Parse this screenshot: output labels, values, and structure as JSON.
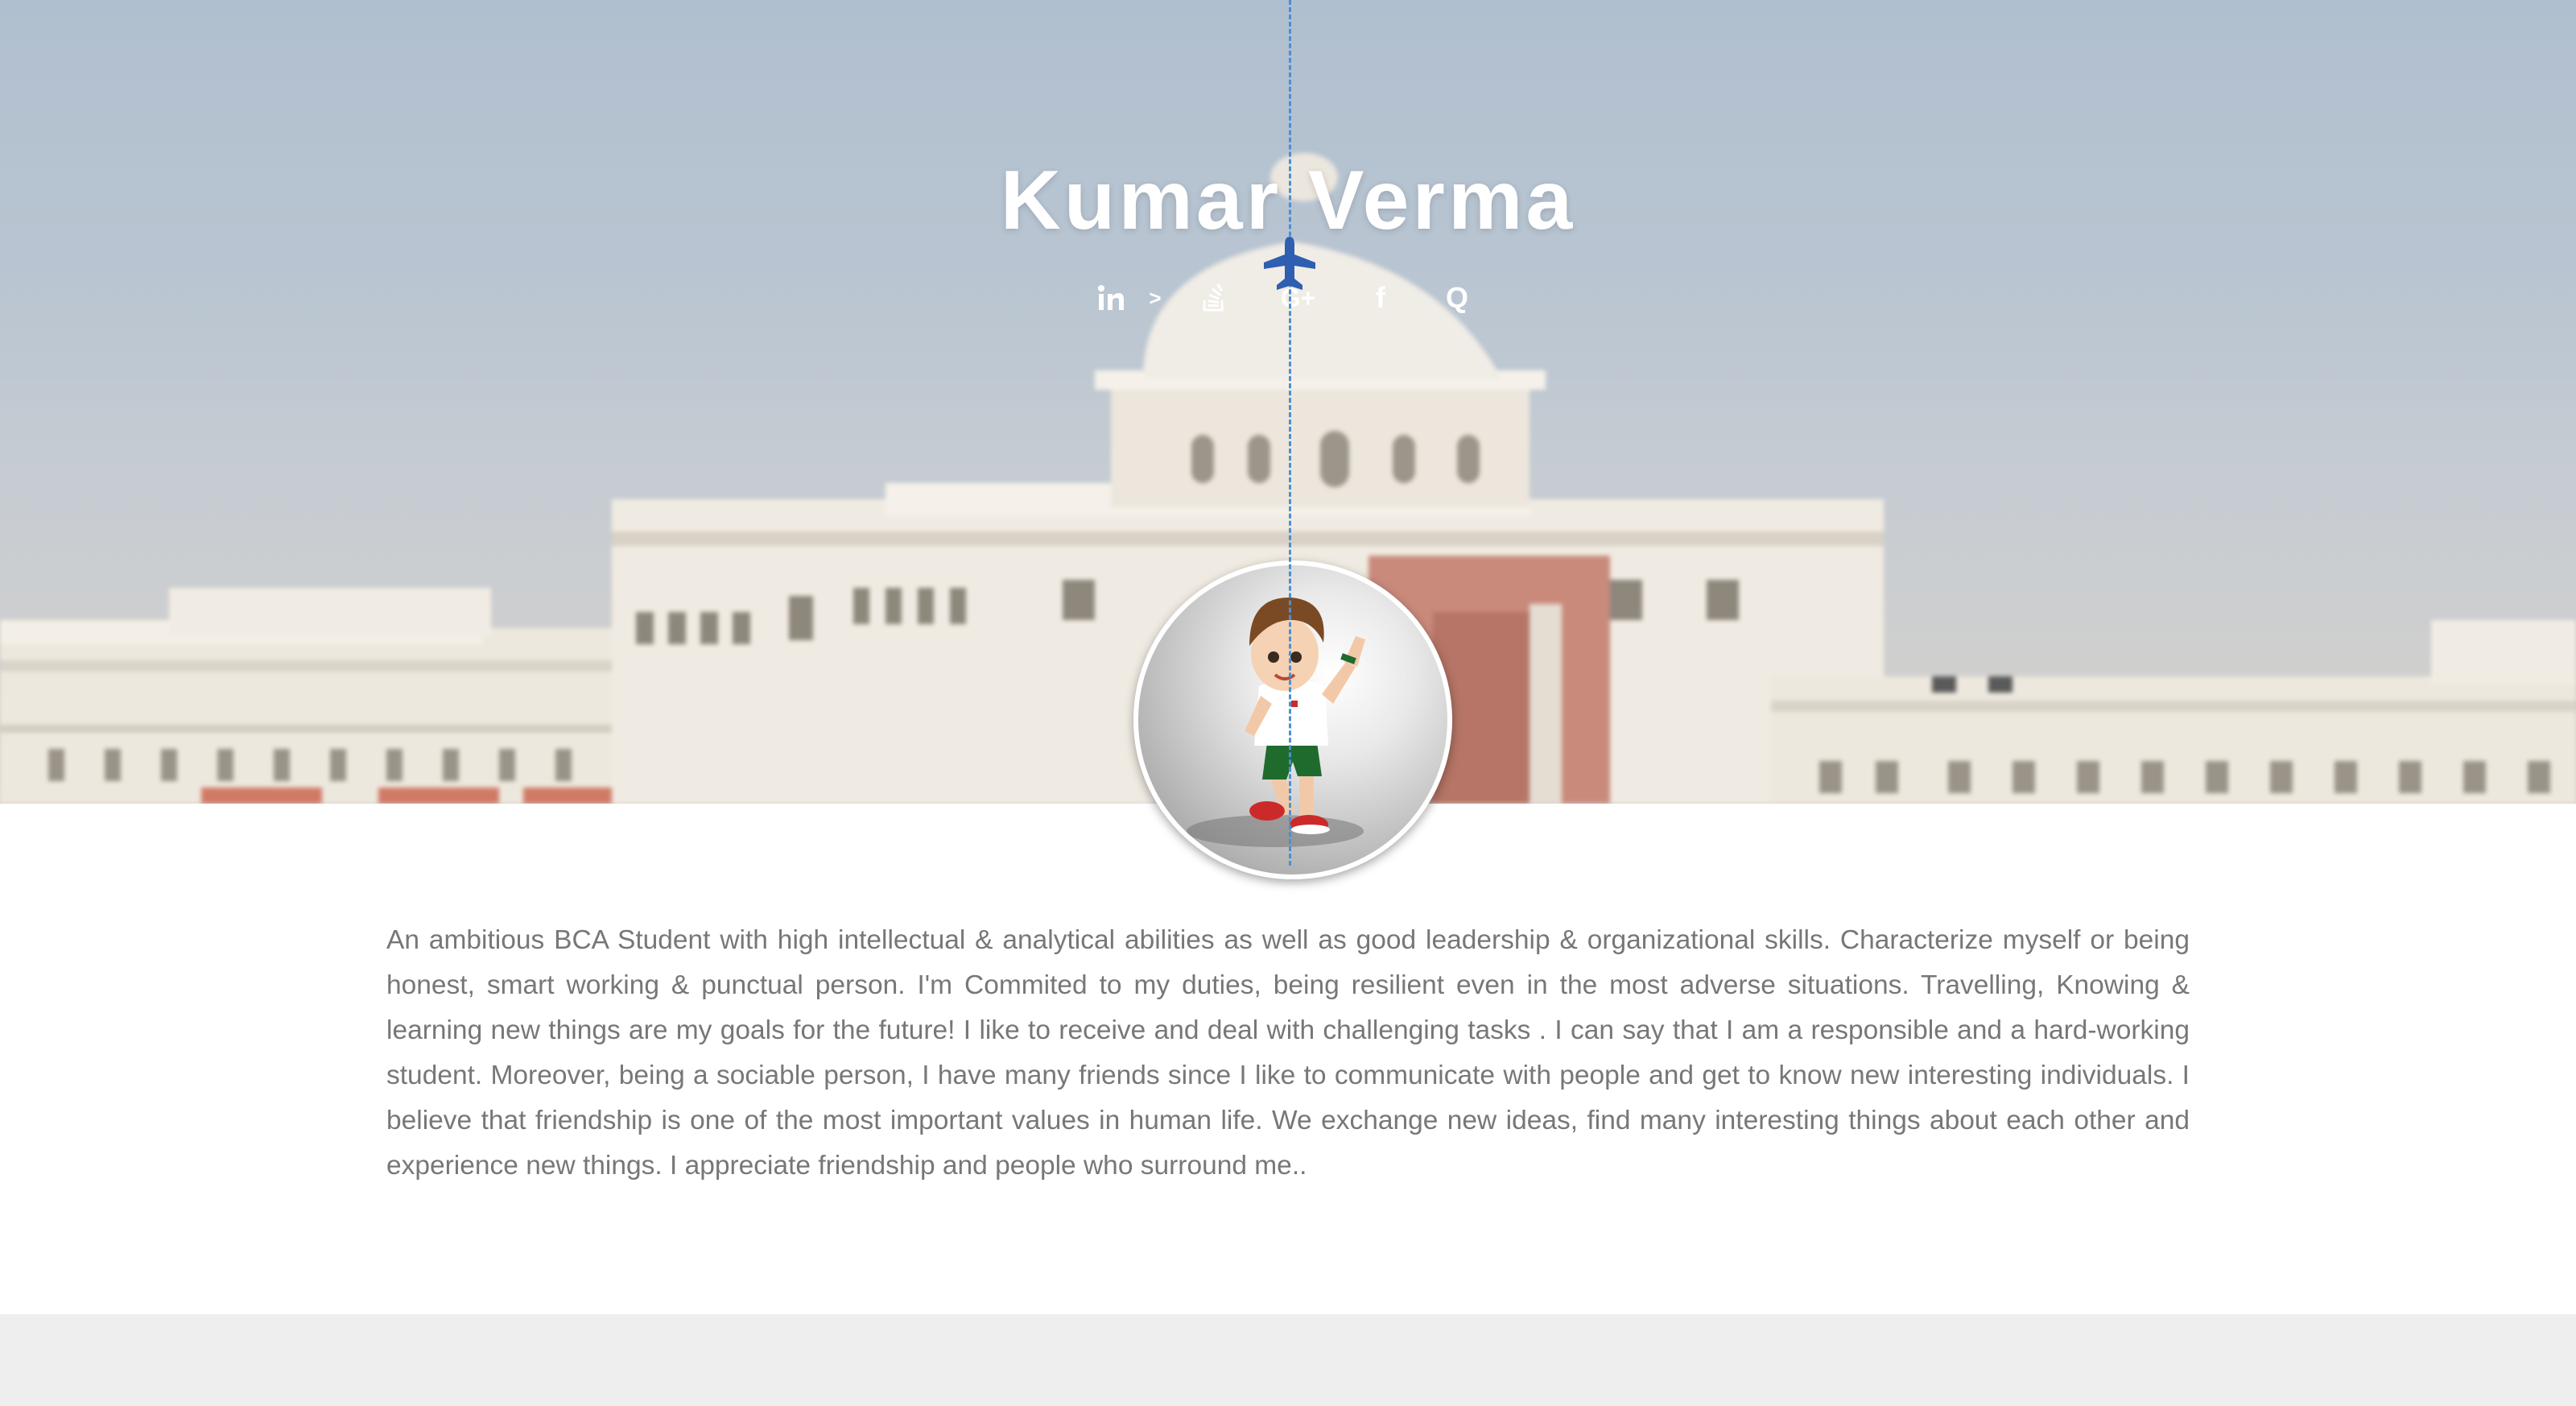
{
  "header": {
    "name": "Kumar Verma"
  },
  "social": [
    {
      "icon": "linkedin-icon",
      "glyph": "in"
    },
    {
      "icon": "chevron-right-icon",
      "glyph": ">"
    },
    {
      "icon": "stackoverflow-icon",
      "glyph": ""
    },
    {
      "icon": "google-plus-icon",
      "glyph": "G+"
    },
    {
      "icon": "facebook-icon",
      "glyph": "f"
    },
    {
      "icon": "quora-icon",
      "glyph": "Q"
    }
  ],
  "about": {
    "text": "An ambitious BCA Student with high intellectual & analytical abilities as well as good leadership & organizational skills. Characterize myself or being honest, smart working & punctual person. I'm Commited to my duties, being resilient even in the most adverse situations. Travelling, Knowing & learning new things are my goals for the future! I like to receive and deal with challenging tasks . I can say that I am a responsible and a hard-working student. Moreover, being a sociable person, I have many friends since I like to communicate with people and get to know new interesting individuals. I believe that friendship is one of the most important values in human life. We exchange new ideas, find many interesting things about each other and experience new things. I appreciate friendship and people who surround me.."
  },
  "colors": {
    "accent": "#2e5fb0",
    "rope": "#4a8fd6",
    "text": "#777777",
    "footer": "#eeeeee"
  }
}
